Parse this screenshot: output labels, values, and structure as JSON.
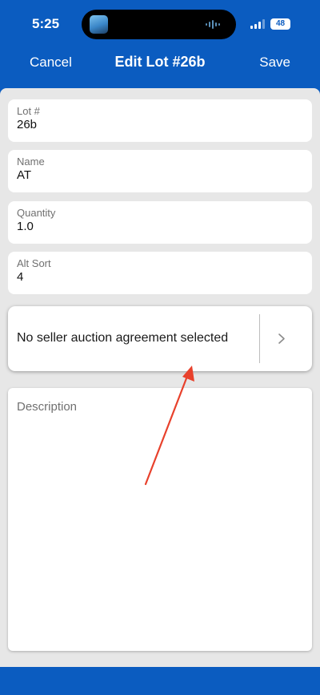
{
  "status_bar": {
    "time": "5:25",
    "battery": "48"
  },
  "nav": {
    "cancel_label": "Cancel",
    "title": "Edit Lot #26b",
    "save_label": "Save"
  },
  "fields": [
    {
      "label": "Lot #",
      "value": "26b"
    },
    {
      "label": "Name",
      "value": "AT"
    },
    {
      "label": "Quantity",
      "value": "1.0"
    },
    {
      "label": "Alt Sort",
      "value": "4"
    }
  ],
  "agreement": {
    "text": "No seller auction agreement selected"
  },
  "description": {
    "placeholder": "Description",
    "value": ""
  },
  "colors": {
    "brand": "#0b5cc0",
    "background": "#e7e7e7",
    "annotation_arrow": "#e8412c"
  },
  "icons": {
    "chevron": "chevron-right-icon",
    "signal": "cellular-signal-icon",
    "battery": "battery-icon"
  }
}
